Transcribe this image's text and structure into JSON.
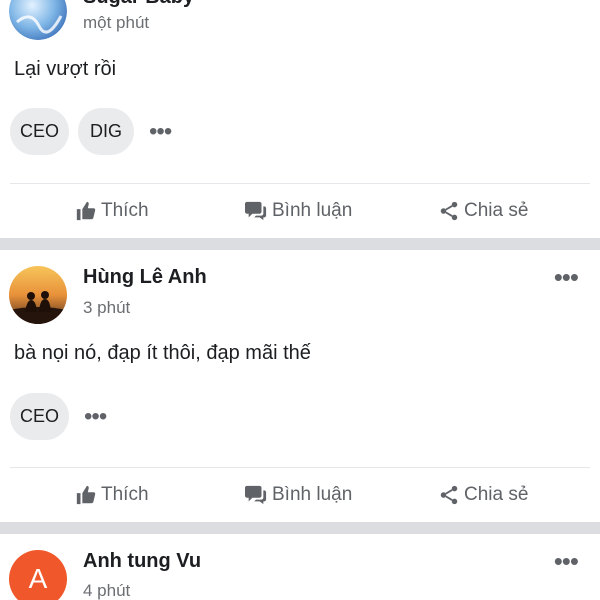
{
  "posts": [
    {
      "author": "Sugar Baby",
      "time": "một phút",
      "content": "Lại vượt rồi",
      "tags": [
        "CEO",
        "DIG"
      ]
    },
    {
      "author": "Hùng Lê Anh",
      "time": "3 phút",
      "content": "bà nọi nó, đạp ít thôi, đạp mãi thế",
      "tags": [
        "CEO"
      ]
    },
    {
      "author": "Anh tung Vu",
      "avatar_letter": "A",
      "time": "4 phút"
    }
  ],
  "actions": {
    "like": "Thích",
    "comment": "Bình luận",
    "share": "Chia sẻ"
  },
  "more_symbol": "•••",
  "colors": {
    "separator": "#dcdde0",
    "avatar_orange": "#f0572a",
    "icon_gray": "#5f6368"
  }
}
